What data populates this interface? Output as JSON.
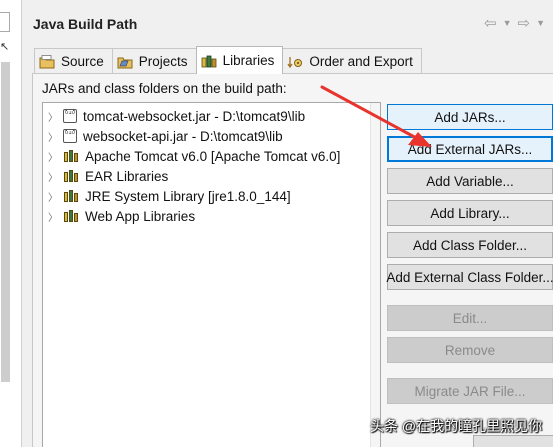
{
  "panel": {
    "title": "Java Build Path"
  },
  "nav": {
    "back_icon": "back-arrow-icon",
    "forward_icon": "forward-arrow-icon"
  },
  "tabs": [
    {
      "label": "Source",
      "icon": "source-folder-icon",
      "active": false
    },
    {
      "label": "Projects",
      "icon": "projects-icon",
      "active": false
    },
    {
      "label": "Libraries",
      "icon": "libraries-icon",
      "active": true
    },
    {
      "label": "Order and Export",
      "icon": "order-export-icon",
      "active": false
    }
  ],
  "libraries": {
    "heading": "JARs and class folders on the build path:",
    "items": [
      {
        "label": "tomcat-websocket.jar - D:\\tomcat9\\lib",
        "icon": "jar-icon"
      },
      {
        "label": "websocket-api.jar - D:\\tomcat9\\lib",
        "icon": "jar-icon"
      },
      {
        "label": "Apache Tomcat v6.0 [Apache Tomcat v6.0]",
        "icon": "library-icon"
      },
      {
        "label": "EAR Libraries",
        "icon": "library-icon"
      },
      {
        "label": "JRE System Library [jre1.8.0_144]",
        "icon": "library-icon"
      },
      {
        "label": "Web App Libraries",
        "icon": "library-icon"
      }
    ]
  },
  "buttons": {
    "add_jars": "Add JARs...",
    "add_external_jars": "Add External JARs...",
    "add_variable": "Add Variable...",
    "add_library": "Add Library...",
    "add_class_folder": "Add Class Folder...",
    "add_external_class_folder": "Add External Class Folder...",
    "edit": "Edit...",
    "remove": "Remove",
    "migrate_jar": "Migrate JAR File..."
  },
  "watermark": {
    "text": "头条 @在我的瞳孔里照见你"
  },
  "colors": {
    "annotation_arrow": "#e8342c",
    "focus_border": "#0078d7"
  }
}
